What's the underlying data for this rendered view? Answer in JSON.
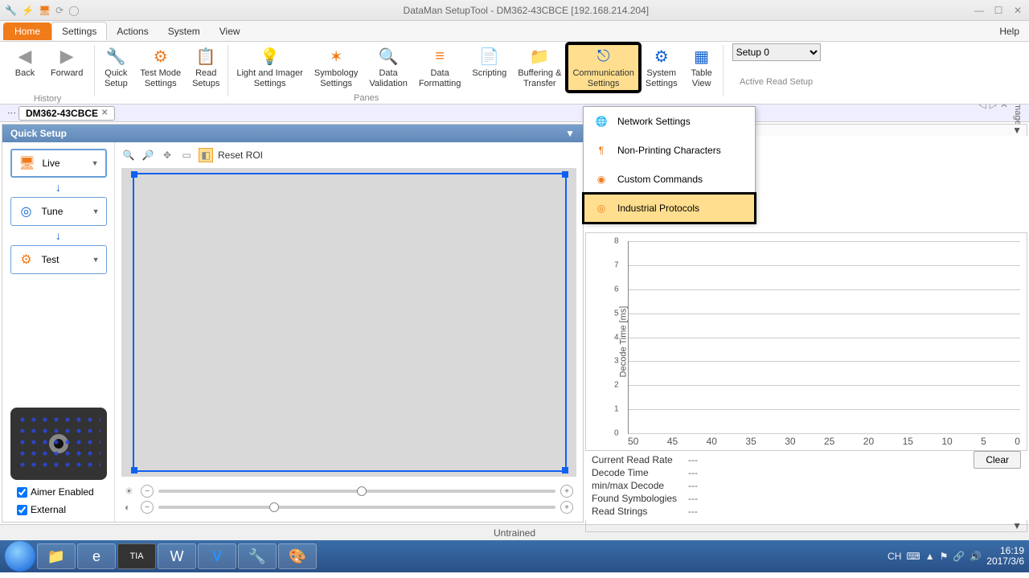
{
  "window": {
    "title": "DataMan SetupTool - DM362-43CBCE [192.168.214.204]"
  },
  "menubar": {
    "home": "Home",
    "settings": "Settings",
    "actions": "Actions",
    "system": "System",
    "view": "View",
    "help": "Help"
  },
  "ribbon": {
    "back": "Back",
    "forward": "Forward",
    "history": "History",
    "quick_setup": "Quick\nSetup",
    "test_mode": "Test Mode\nSettings",
    "read_setups": "Read\nSetups",
    "light_imager": "Light and Imager\nSettings",
    "symbology": "Symbology\nSettings",
    "data_validation": "Data\nValidation",
    "data_formatting": "Data\nFormatting",
    "scripting": "Scripting",
    "buffering": "Buffering &\nTransfer",
    "comm": "Communication\nSettings",
    "sys_settings": "System\nSettings",
    "table_view": "Table\nView",
    "panes": "Panes",
    "active_setup": "Active Read Setup",
    "setup_select": "Setup 0"
  },
  "tab": {
    "name": "DM362-43CBCE"
  },
  "quick_setup": {
    "title": "Quick Setup",
    "live": "Live",
    "tune": "Tune",
    "test": "Test",
    "aimer": "Aimer Enabled",
    "external": "External",
    "reset_roi": "Reset ROI"
  },
  "comm_menu": {
    "network": "Network Settings",
    "nonprint": "Non-Printing Characters",
    "custom": "Custom Commands",
    "industrial": "Industrial Protocols"
  },
  "chart_data": {
    "type": "line",
    "title": "",
    "ylabel": "Decode Time [ms]",
    "xlabel": "",
    "ylim": [
      0,
      8
    ],
    "yticks": [
      0,
      1,
      2,
      3,
      4,
      5,
      6,
      7,
      8
    ],
    "xticks": [
      50,
      45,
      40,
      35,
      30,
      25,
      20,
      15,
      10,
      5,
      0
    ],
    "series": [
      {
        "name": "Decode Time",
        "values": []
      }
    ]
  },
  "stats": {
    "current_read_rate": {
      "label": "Current Read Rate",
      "value": "---"
    },
    "decode_time": {
      "label": "Decode Time",
      "value": "---"
    },
    "minmax": {
      "label": "min/max Decode",
      "value": "---"
    },
    "found_symb": {
      "label": "Found Symbologies",
      "value": "---"
    },
    "read_strings": {
      "label": "Read Strings",
      "value": "---"
    },
    "clear": "Clear"
  },
  "status": "Untrained",
  "side": {
    "image": "Image"
  },
  "tray": {
    "ime": "CH",
    "time": "16:19",
    "date": "2017/3/6"
  }
}
